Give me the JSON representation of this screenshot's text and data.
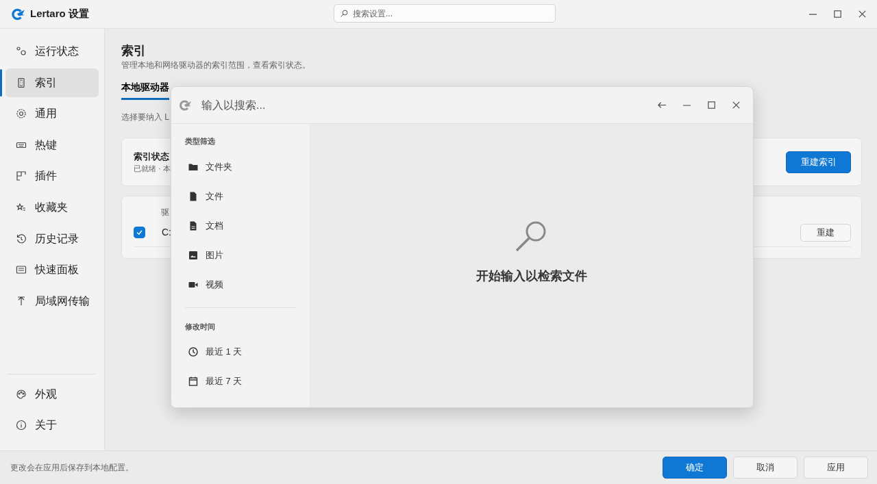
{
  "app": {
    "title": "Lertaro 设置",
    "search": {
      "placeholder": "搜索设置..."
    }
  },
  "sidebar": {
    "items": [
      {
        "label": "运行状态",
        "selected": false
      },
      {
        "label": "索引",
        "selected": true
      },
      {
        "label": "通用",
        "selected": false
      },
      {
        "label": "热键",
        "selected": false
      },
      {
        "label": "插件",
        "selected": false
      },
      {
        "label": "收藏夹",
        "selected": false
      },
      {
        "label": "历史记录",
        "selected": false
      },
      {
        "label": "快速面板",
        "selected": false
      },
      {
        "label": "局域网传输",
        "selected": false
      }
    ],
    "bottom_items": [
      {
        "label": "外观",
        "selected": false
      },
      {
        "label": "关于",
        "selected": false
      }
    ]
  },
  "page": {
    "title": "索引",
    "subtitle": "管理本地和网络驱动器的索引范围，查看索引状态。",
    "tabs": [
      {
        "label": "本地驱动器",
        "selected": true
      }
    ],
    "hint": "选择要纳入 L",
    "status_card": {
      "title": "索引状态",
      "detail": "已就绪 · 本",
      "button": "重建索引"
    },
    "drives": {
      "column_1": "驱",
      "rows": [
        {
          "checked": true,
          "name": "C:",
          "button": "重建"
        }
      ]
    }
  },
  "search_popup": {
    "placeholder": "输入以搜索...",
    "filter_groups": [
      {
        "title": "类型筛选",
        "items": [
          {
            "label": "文件夹"
          },
          {
            "label": "文件"
          },
          {
            "label": "文档"
          },
          {
            "label": "图片"
          },
          {
            "label": "视频"
          }
        ]
      },
      {
        "title": "修改时间",
        "items": [
          {
            "label": "最近 1 天"
          },
          {
            "label": "最近 7 天"
          }
        ]
      }
    ],
    "empty_message": "开始输入以检索文件"
  },
  "footer": {
    "note": "更改会在应用后保存到本地配置。",
    "buttons": [
      {
        "label": "确定",
        "kind": "primary"
      },
      {
        "label": "取消",
        "kind": "secondary"
      },
      {
        "label": "应用",
        "kind": "secondary"
      }
    ]
  }
}
